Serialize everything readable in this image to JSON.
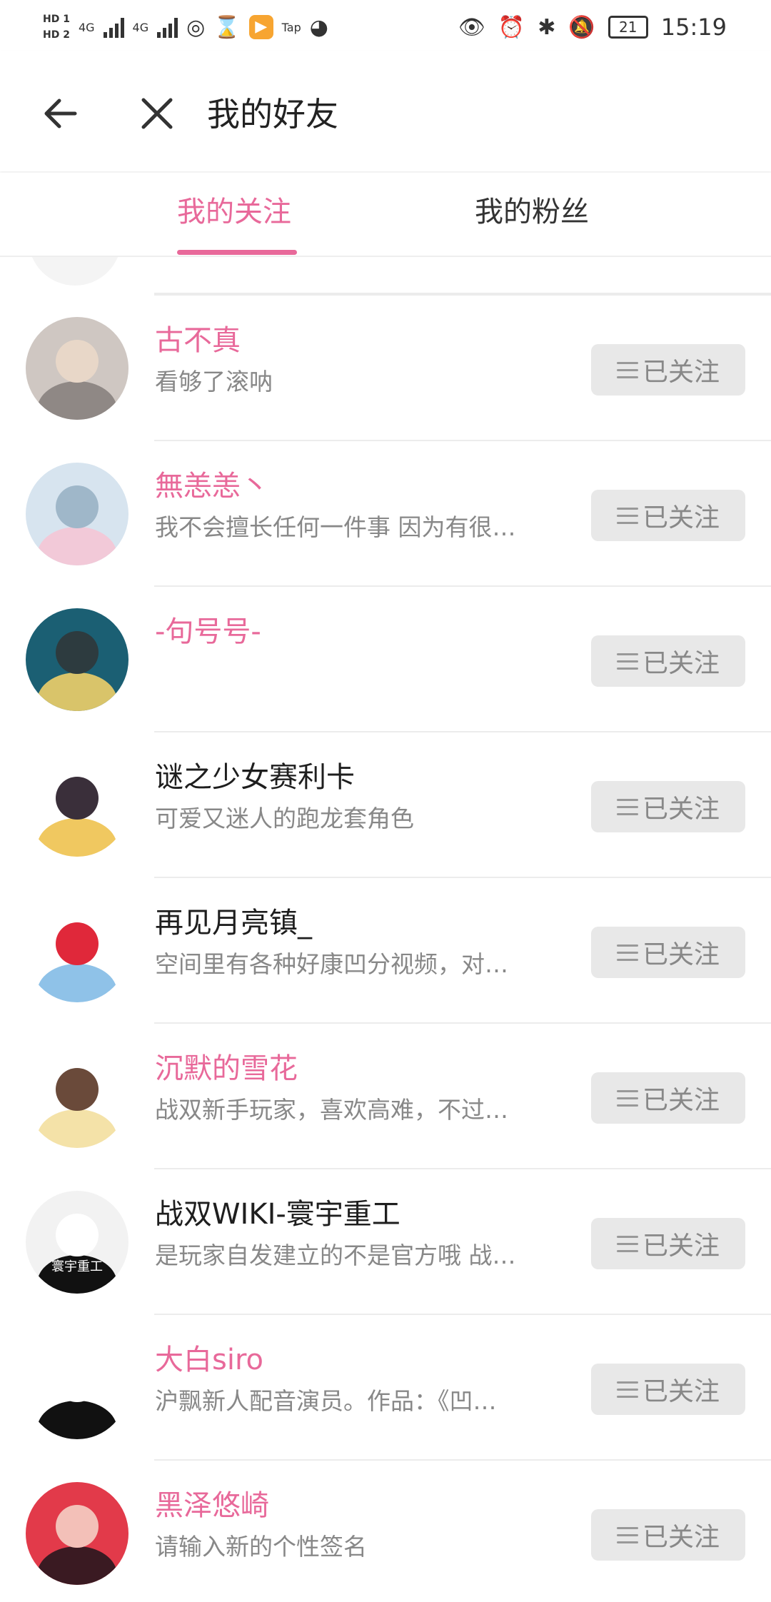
{
  "status_bar": {
    "hd1": "HD 1",
    "hd2": "HD 2",
    "net1": "4G",
    "net2": "4G",
    "tap_label": "Tap",
    "battery": "21",
    "time": "15:19"
  },
  "header": {
    "title": "我的好友"
  },
  "tabs": [
    {
      "label": "我的关注",
      "active": true
    },
    {
      "label": "我的粉丝",
      "active": false
    }
  ],
  "colors": {
    "accent": "#e8699a",
    "button_bg": "#e8e8e8",
    "button_text": "#888888"
  },
  "follow_button_label": "已关注",
  "users": [
    {
      "name": "古不真",
      "bio": "看够了滚呐",
      "name_color": "pink",
      "avatar_colors": [
        "#cfc7c2",
        "#8f8885",
        "#e8d7c8"
      ]
    },
    {
      "name": "無恙恙丶",
      "bio": "我不会擅长任何一件事 因为有很…",
      "name_color": "pink",
      "avatar_colors": [
        "#d7e4ef",
        "#f2c9d8",
        "#9fb7c9"
      ]
    },
    {
      "name": "-句号号-",
      "bio": "",
      "name_color": "pink",
      "avatar_colors": [
        "#1b5f73",
        "#d9c46a",
        "#2d3b3f"
      ]
    },
    {
      "name": "谜之少女赛利卡",
      "bio": "可爱又迷人的跑龙套角色",
      "name_color": "dark",
      "avatar_colors": [
        "#ffffff",
        "#f0c860",
        "#3a2f3a"
      ]
    },
    {
      "name": "再见月亮镇_",
      "bio": "空间里有各种好康凹分视频，对…",
      "name_color": "dark",
      "avatar_colors": [
        "#ffffff",
        "#8fc2e8",
        "#e0283a"
      ]
    },
    {
      "name": "沉默的雪花",
      "bio": "战双新手玩家，喜欢高难，不过…",
      "name_color": "pink",
      "avatar_colors": [
        "#ffffff",
        "#f4e2a8",
        "#6a4a3a"
      ]
    },
    {
      "name": "战双WIKI-寰宇重工",
      "bio": "是玩家自发建立的不是官方哦 战…",
      "name_color": "dark",
      "avatar_colors": [
        "#f2f2f2",
        "#111111",
        "#ffffff"
      ],
      "avatar_text": "寰宇重工"
    },
    {
      "name": "大白siro",
      "bio": "沪飘新人配音演员。作品：《凹…",
      "name_color": "pink",
      "avatar_colors": [
        "#ffffff",
        "#111111",
        "#ffffff"
      ]
    },
    {
      "name": "黑泽悠崎",
      "bio": "请输入新的个性签名",
      "name_color": "pink",
      "avatar_colors": [
        "#e23a4a",
        "#3a1a22",
        "#f3c0b8"
      ]
    }
  ]
}
